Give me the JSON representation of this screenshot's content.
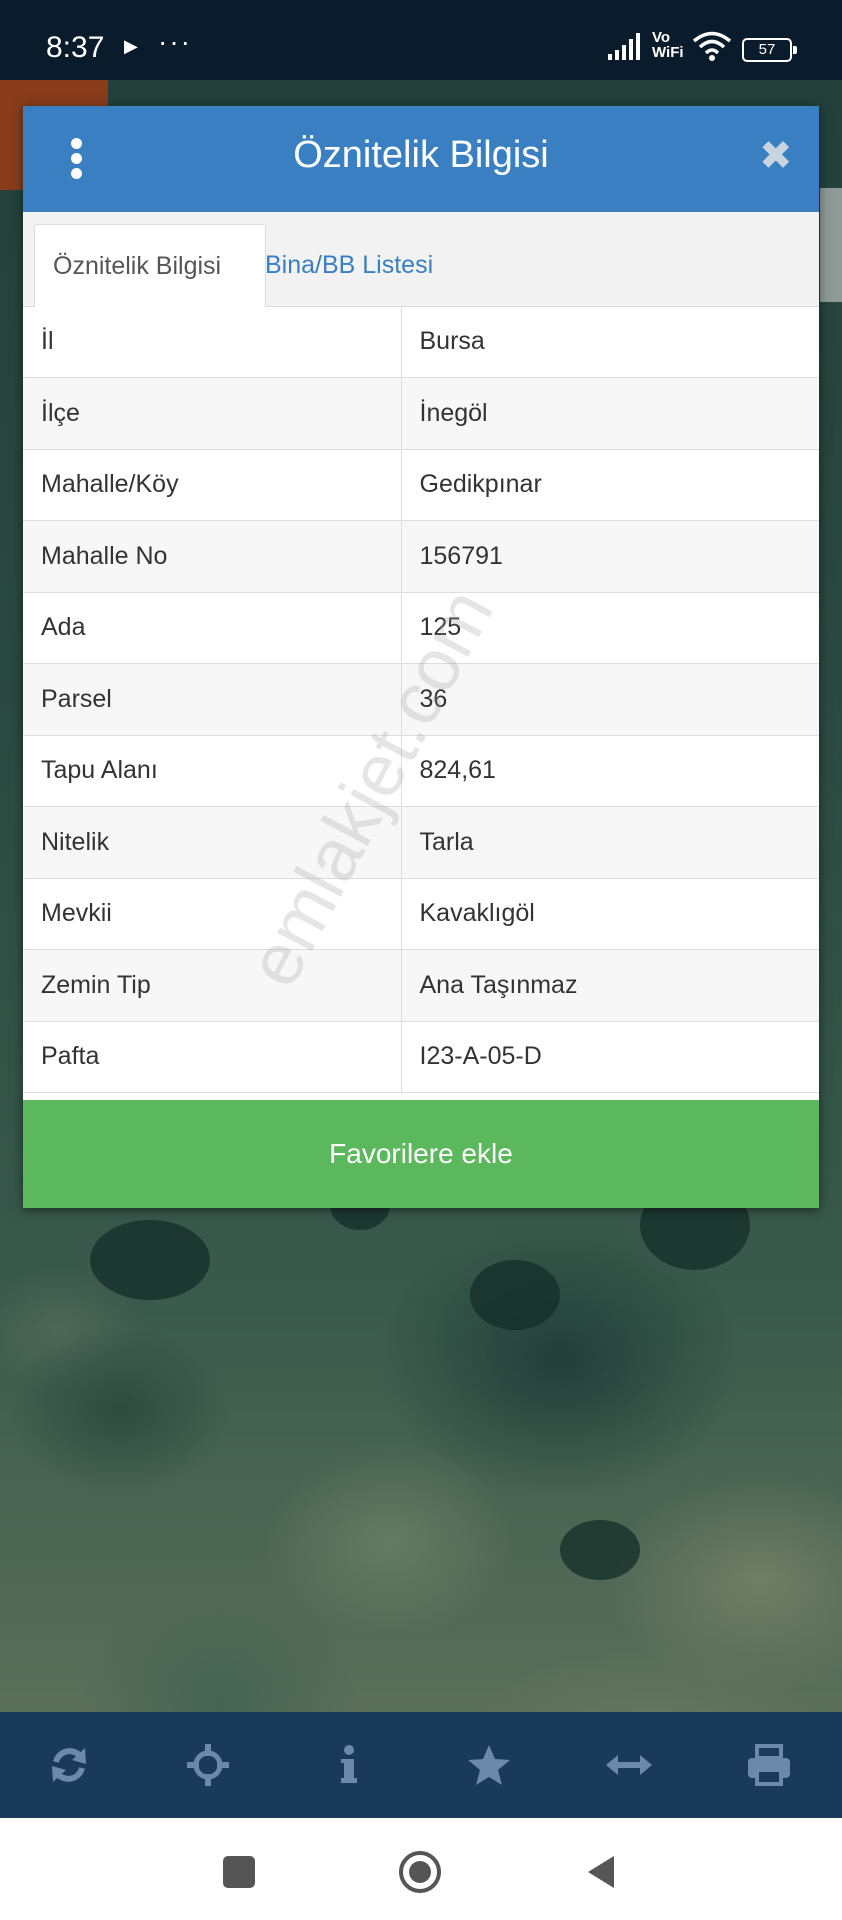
{
  "status_bar": {
    "time": "8:37",
    "play_glyph": "▶",
    "more_glyph": "···",
    "vowifi_line1": "Vo",
    "vowifi_line2": "WiFi",
    "battery": "57"
  },
  "modal": {
    "title": "Öznitelik Bilgisi",
    "close_glyph": "✖",
    "tabs": [
      {
        "label": "Öznitelik Bilgisi",
        "active": true
      },
      {
        "label": "Bina/BB Listesi",
        "active": false
      }
    ],
    "rows": [
      {
        "key": "İl",
        "value": "Bursa"
      },
      {
        "key": "İlçe",
        "value": "İnegöl"
      },
      {
        "key": "Mahalle/Köy",
        "value": "Gedikpınar"
      },
      {
        "key": "Mahalle No",
        "value": "156791"
      },
      {
        "key": "Ada",
        "value": "125"
      },
      {
        "key": "Parsel",
        "value": "36"
      },
      {
        "key": "Tapu Alanı",
        "value": "824,61"
      },
      {
        "key": "Nitelik",
        "value": "Tarla"
      },
      {
        "key": "Mevkii",
        "value": "Kavaklıgöl"
      },
      {
        "key": "Zemin Tip",
        "value": "Ana Taşınmaz"
      },
      {
        "key": "Pafta",
        "value": "I23-A-05-D"
      }
    ],
    "favorite_label": "Favorilere ekle",
    "watermark": "emlakjet.com"
  },
  "toolbar": {
    "icons": [
      "refresh-icon",
      "crosshair-icon",
      "info-icon",
      "star-icon",
      "measure-icon",
      "print-icon"
    ]
  },
  "nav": {
    "icons": [
      "recents-icon",
      "home-icon",
      "back-icon"
    ]
  },
  "colors": {
    "header_blue": "#3a7fc2",
    "favorite_green": "#5cb85c",
    "toolbar_navy": "#1a3a5c",
    "status_bar": "#0a1b2c"
  }
}
